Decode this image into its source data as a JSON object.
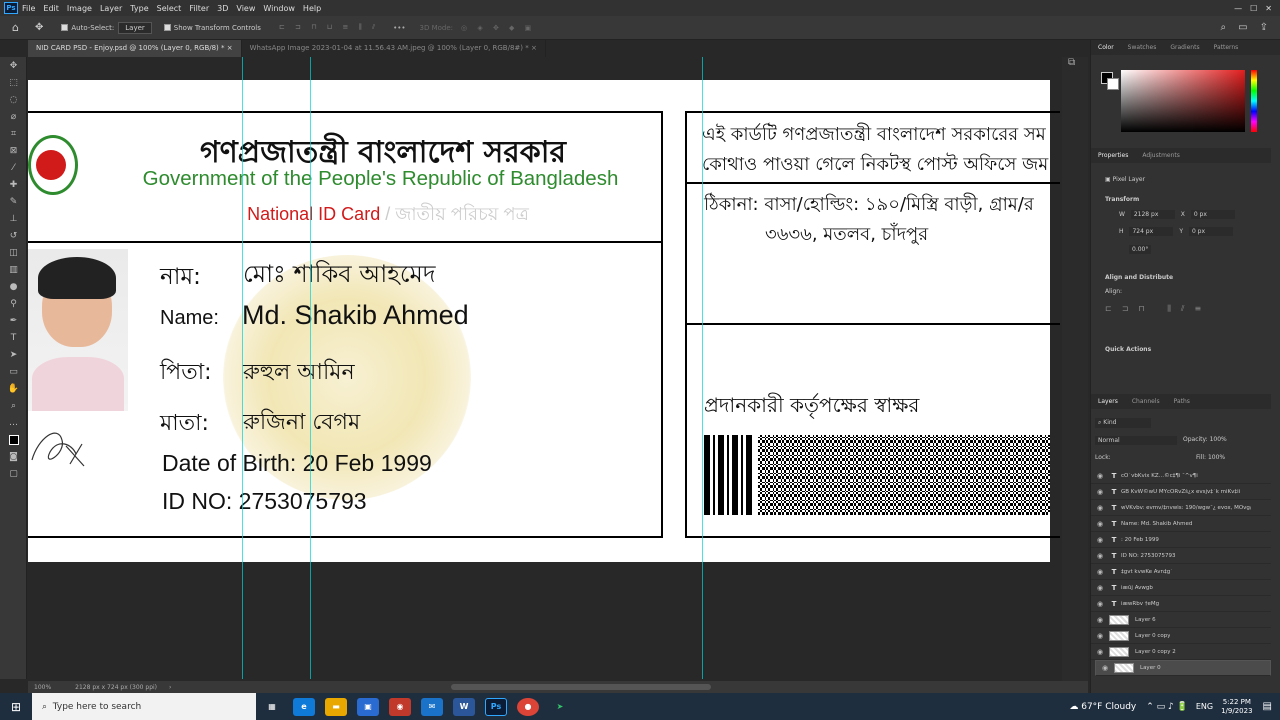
{
  "app": {
    "logo": "Ps"
  },
  "menu": [
    "File",
    "Edit",
    "Image",
    "Layer",
    "Type",
    "Select",
    "Filter",
    "3D",
    "View",
    "Window",
    "Help"
  ],
  "options": {
    "auto_select": "Auto-Select:",
    "layer_select": "Layer",
    "show_transform": "Show Transform Controls",
    "mode_3d": "3D Mode:"
  },
  "tabs": [
    {
      "label": "NID CARD PSD - Enjoy.psd @ 100% (Layer 0, RGB/8) *"
    },
    {
      "label": "WhatsApp Image 2023-01-04 at 11.56.43 AM.jpeg @ 100% (Layer 0, RGB/8#) *"
    }
  ],
  "card": {
    "gov_bn": "গণপ্রজাতন্ত্রী বাংলাদেশ সরকার",
    "gov_en": "Government of the People's Republic of Bangladesh",
    "nid_en": "National ID Card",
    "nid_sep": " / ",
    "nid_bn": "জাতীয় পরিচয় পত্র",
    "name_label_bn": "নাম:",
    "name_bn": "মোঃ শাকিব আহমেদ",
    "name_label_en": "Name:",
    "name_en": "Md. Shakib Ahmed",
    "father_label": "পিতা:",
    "father": "রুহুল আমিন",
    "mother_label": "মাতা:",
    "mother": "রুজিনা বেগম",
    "dob": "Date of Birth: 20 Feb 1999",
    "id_no": "ID NO: 2753075793",
    "back_line1": "এই কার্ডটি গণপ্রজাতন্ত্রী বাংলাদেশ সরকারের সম",
    "back_line2": "কোথাও পাওয়া গেলে নিকটস্থ পোস্ট অফিসে জম",
    "address_line1": "ঠিকানা: বাসা/হোল্ডিং: ১৯০/মিস্ত্রি বাড়ী, গ্রাম/র",
    "address_line2": "৩৬৩৬, মতলব, চাঁদপুর",
    "signer": "প্রদানকারী কর্তৃপক্ষের স্বাক্ষর",
    "colors": {
      "green": "#2e8b2e",
      "red": "#d11a1a"
    }
  },
  "status": {
    "zoom": "100%",
    "doc_info": "2128 px x 724 px (300 ppi)"
  },
  "panels": {
    "color_tabs": [
      "Color",
      "Swatches",
      "Gradients",
      "Patterns"
    ],
    "props_tabs": [
      "Properties",
      "Adjustments"
    ],
    "pixel_layer": "Pixel Layer",
    "transform": "Transform",
    "w": "W",
    "w_val": "2128 px",
    "x": "X",
    "x_val": "0 px",
    "h": "H",
    "h_val": "724 px",
    "y": "Y",
    "y_val": "0 px",
    "angle": "0.00°",
    "align": "Align and Distribute",
    "align_sub": "Align:",
    "quick": "Quick Actions",
    "layers_tabs": [
      "Layers",
      "Channels",
      "Paths"
    ],
    "kind": "Kind",
    "blend": "Normal",
    "opacity_label": "Opacity:",
    "opacity": "100%",
    "lock_label": "Lock:",
    "fill_label": "Fill:",
    "fill": "100%"
  },
  "layers": [
    {
      "type": "T",
      "name": "cÖ`vbKvix KZ…©c‡¶i ¯^v¶i"
    },
    {
      "type": "T",
      "name": "GB KvW©wU MYcÖRvZš¿x evsjv‡`k miKv‡ii"
    },
    {
      "type": "T",
      "name": "wVKvbv: evmv/‡nvwìs: 190/wgw¯¿ evox, MÖvg/"
    },
    {
      "type": "T",
      "name": "Name:  Md. Shakib Ahmed"
    },
    {
      "type": "T",
      "name": ": 20 Feb 1999"
    },
    {
      "type": "T",
      "name": "ID NO: 2753075793"
    },
    {
      "type": "T",
      "name": "‡gvt kvwKe Avn‡g`"
    },
    {
      "type": "T",
      "name": "iæûj Avwgb"
    },
    {
      "type": "T",
      "name": "iæwRbv †eMg"
    },
    {
      "type": "P",
      "name": "Layer 6"
    },
    {
      "type": "P",
      "name": "Layer 0 copy"
    },
    {
      "type": "P",
      "name": "Layer 0 copy 2"
    },
    {
      "type": "P",
      "name": "Layer 0",
      "selected": true
    }
  ],
  "taskbar": {
    "search": "Type here to search",
    "weather": "67°F  Cloudy",
    "lang": "ENG",
    "time": "5:22 PM",
    "date": "1/9/2023"
  }
}
